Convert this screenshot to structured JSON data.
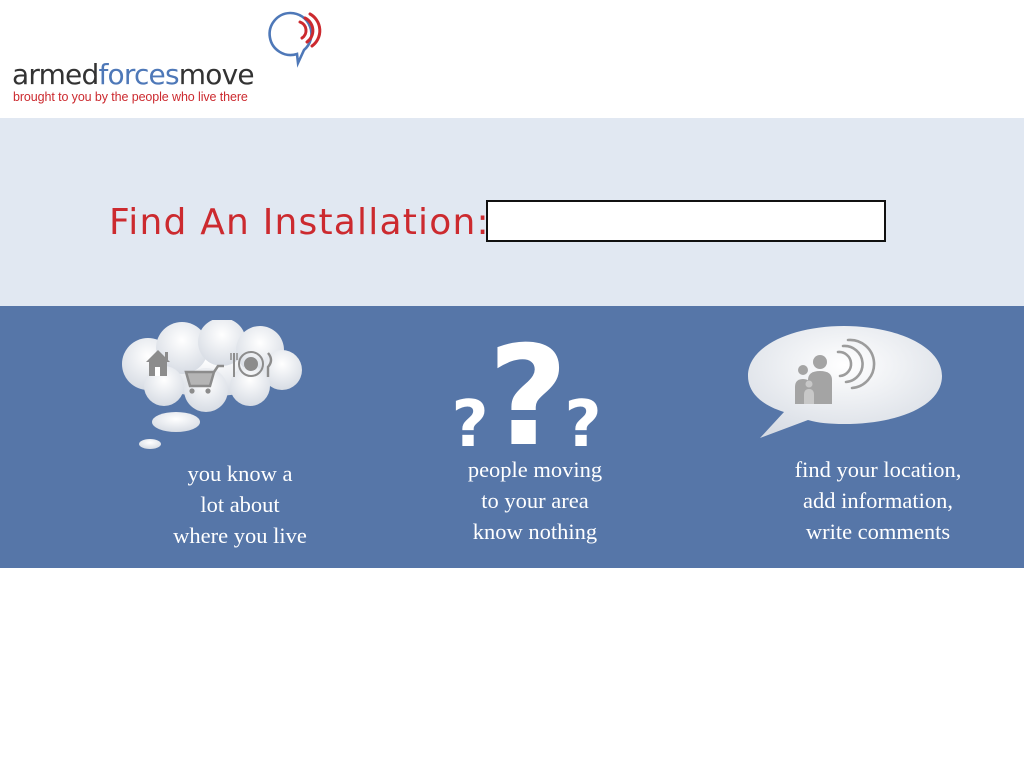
{
  "logo": {
    "name_part1": "armed",
    "name_part2": "forces",
    "name_part3": "move",
    "tagline": "brought to you by the people who live there",
    "icon": "speech-bubble-signal-icon"
  },
  "search": {
    "label": "Find An Installation:",
    "value": "",
    "placeholder": ""
  },
  "features": [
    {
      "icon": "thought-cloud-icon",
      "lines": [
        "you know a",
        "lot about",
        "where you live"
      ]
    },
    {
      "icon": "question-marks-icon",
      "lines": [
        "people moving",
        "to your area",
        "know nothing"
      ]
    },
    {
      "icon": "speech-bubble-family-icon",
      "lines": [
        "find your location,",
        "add information,",
        "write comments"
      ]
    }
  ],
  "colors": {
    "brand_red": "#cc2a2f",
    "brand_blue": "#4e78b8",
    "band_light": "#e1e8f2",
    "band_dark": "#5676a8"
  }
}
